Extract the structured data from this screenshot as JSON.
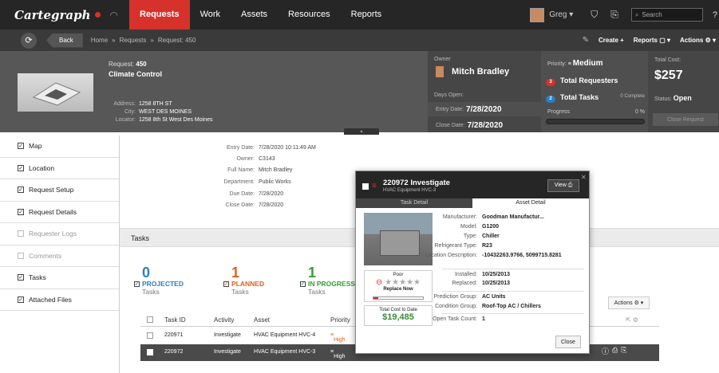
{
  "app": {
    "logo": "Cartegraph",
    "nav": [
      "Requests",
      "Work",
      "Assets",
      "Resources",
      "Reports"
    ],
    "user": "Greg",
    "search_placeholder": "Search",
    "help": "?"
  },
  "toolbar": {
    "back": "Back",
    "crumbs": [
      "Home",
      "»",
      "Requests",
      "»",
      "Request: 450"
    ],
    "create": "Create +",
    "reports": "Reports ▢ ▾",
    "actions": "Actions ⚙ ▾"
  },
  "request": {
    "label": "Request:",
    "number": "450",
    "title": "Climate Control",
    "address_rows": [
      {
        "k": "Address:",
        "v": "1258 8TH ST"
      },
      {
        "k": "City:",
        "v": "WEST DES MOINES"
      },
      {
        "k": "Locator:",
        "v": "1258 8th St West Des Moines"
      }
    ]
  },
  "owner": {
    "label": "Owner",
    "name": "Mitch Bradley",
    "days_open": "Days Open:",
    "entry_label": "Entry Date:",
    "entry_date": "7/28/2020",
    "close_label": "Close Date:",
    "close_date": "7/28/2020"
  },
  "priority": {
    "label": "Priority:",
    "value": "Medium",
    "requesters_count": "3",
    "requesters": "Total Requesters",
    "tasks_count": "2",
    "tasks": "Total Tasks",
    "complete": "0 Complete",
    "progress_label": "Progress",
    "progress_pct": "0 %",
    "progress_value": 0
  },
  "cost": {
    "label": "Total Cost:",
    "value": "$257",
    "status_label": "Status:",
    "status": "Open",
    "close_btn": "Close Request"
  },
  "sidebar": [
    {
      "label": "Map",
      "checked": true
    },
    {
      "label": "Location",
      "checked": true
    },
    {
      "label": "Request Setup",
      "checked": true
    },
    {
      "label": "Request Details",
      "checked": true
    },
    {
      "label": "Requester Logs",
      "checked": false
    },
    {
      "label": "Comments",
      "checked": false
    },
    {
      "label": "Tasks",
      "checked": true
    },
    {
      "label": "Attached Files",
      "checked": true
    }
  ],
  "details": [
    {
      "k": "Entry Date:",
      "v": "7/28/2020 10:11:49 AM"
    },
    {
      "k": "Owner:",
      "v": "C3143"
    },
    {
      "k": "Full Name:",
      "v": "Mitch Bradley"
    },
    {
      "k": "Department:",
      "v": "Public Works"
    },
    {
      "k": "Due Date:",
      "v": "7/28/2020"
    },
    {
      "k": "Close Date:",
      "v": "7/28/2020"
    }
  ],
  "tasks": {
    "header": "Tasks",
    "counters": [
      {
        "n": "0",
        "label": "PROJECTED",
        "sub": "Tasks",
        "color": "#2a7fc4"
      },
      {
        "n": "1",
        "label": "PLANNED",
        "sub": "Tasks",
        "color": "#e06020"
      },
      {
        "n": "1",
        "label": "IN PROGRESS",
        "sub": "Tasks",
        "color": "#3a9a3a"
      }
    ],
    "actions": "Actions ⚙ ▾",
    "columns": [
      "Task ID",
      "Activity",
      "Asset",
      "Priority"
    ],
    "rows": [
      {
        "id": "220971",
        "activity": "Investigate",
        "asset": "HVAC Equipment HVC-4",
        "priority": "High"
      },
      {
        "id": "220972",
        "activity": "Investigate",
        "asset": "HVAC Equipment HVC-3",
        "priority": "High"
      }
    ]
  },
  "popup": {
    "title": "220972 Investigate",
    "subtitle": "HVAC Equipment HVC-3",
    "view": "View ⎙",
    "close_x": "✕",
    "tabs": [
      "Task Detail",
      "Asset Detail"
    ],
    "rating_title": "Poor",
    "rating_stars": "★★★★★",
    "rating_note": "Replace Now",
    "rating_value": 0.1,
    "cost_title": "Total Cost to Date",
    "cost_value": "$19,485",
    "fields_a": [
      {
        "k": "Manufacturer:",
        "v": "Goodman Manufactur..."
      },
      {
        "k": "Model:",
        "v": "G1200"
      },
      {
        "k": "Type:",
        "v": "Chiller"
      },
      {
        "k": "Refrigerant Type:",
        "v": "R23"
      },
      {
        "k": "Location Description:",
        "v": "-10432263.9766, 5099715.8281"
      }
    ],
    "fields_b": [
      {
        "k": "Installed:",
        "v": "10/25/2013"
      },
      {
        "k": "Replaced:",
        "v": "10/25/2013"
      }
    ],
    "fields_c": [
      {
        "k": "Prediction Group:",
        "v": "AC Units"
      },
      {
        "k": "Condition Group:",
        "v": "Roof-Top AC / Chillers"
      }
    ],
    "fields_d": [
      {
        "k": "Open Task Count:",
        "v": "1"
      }
    ],
    "close": "Close"
  },
  "colors": {
    "accent": "#d7312c",
    "topbar": "#262626"
  }
}
